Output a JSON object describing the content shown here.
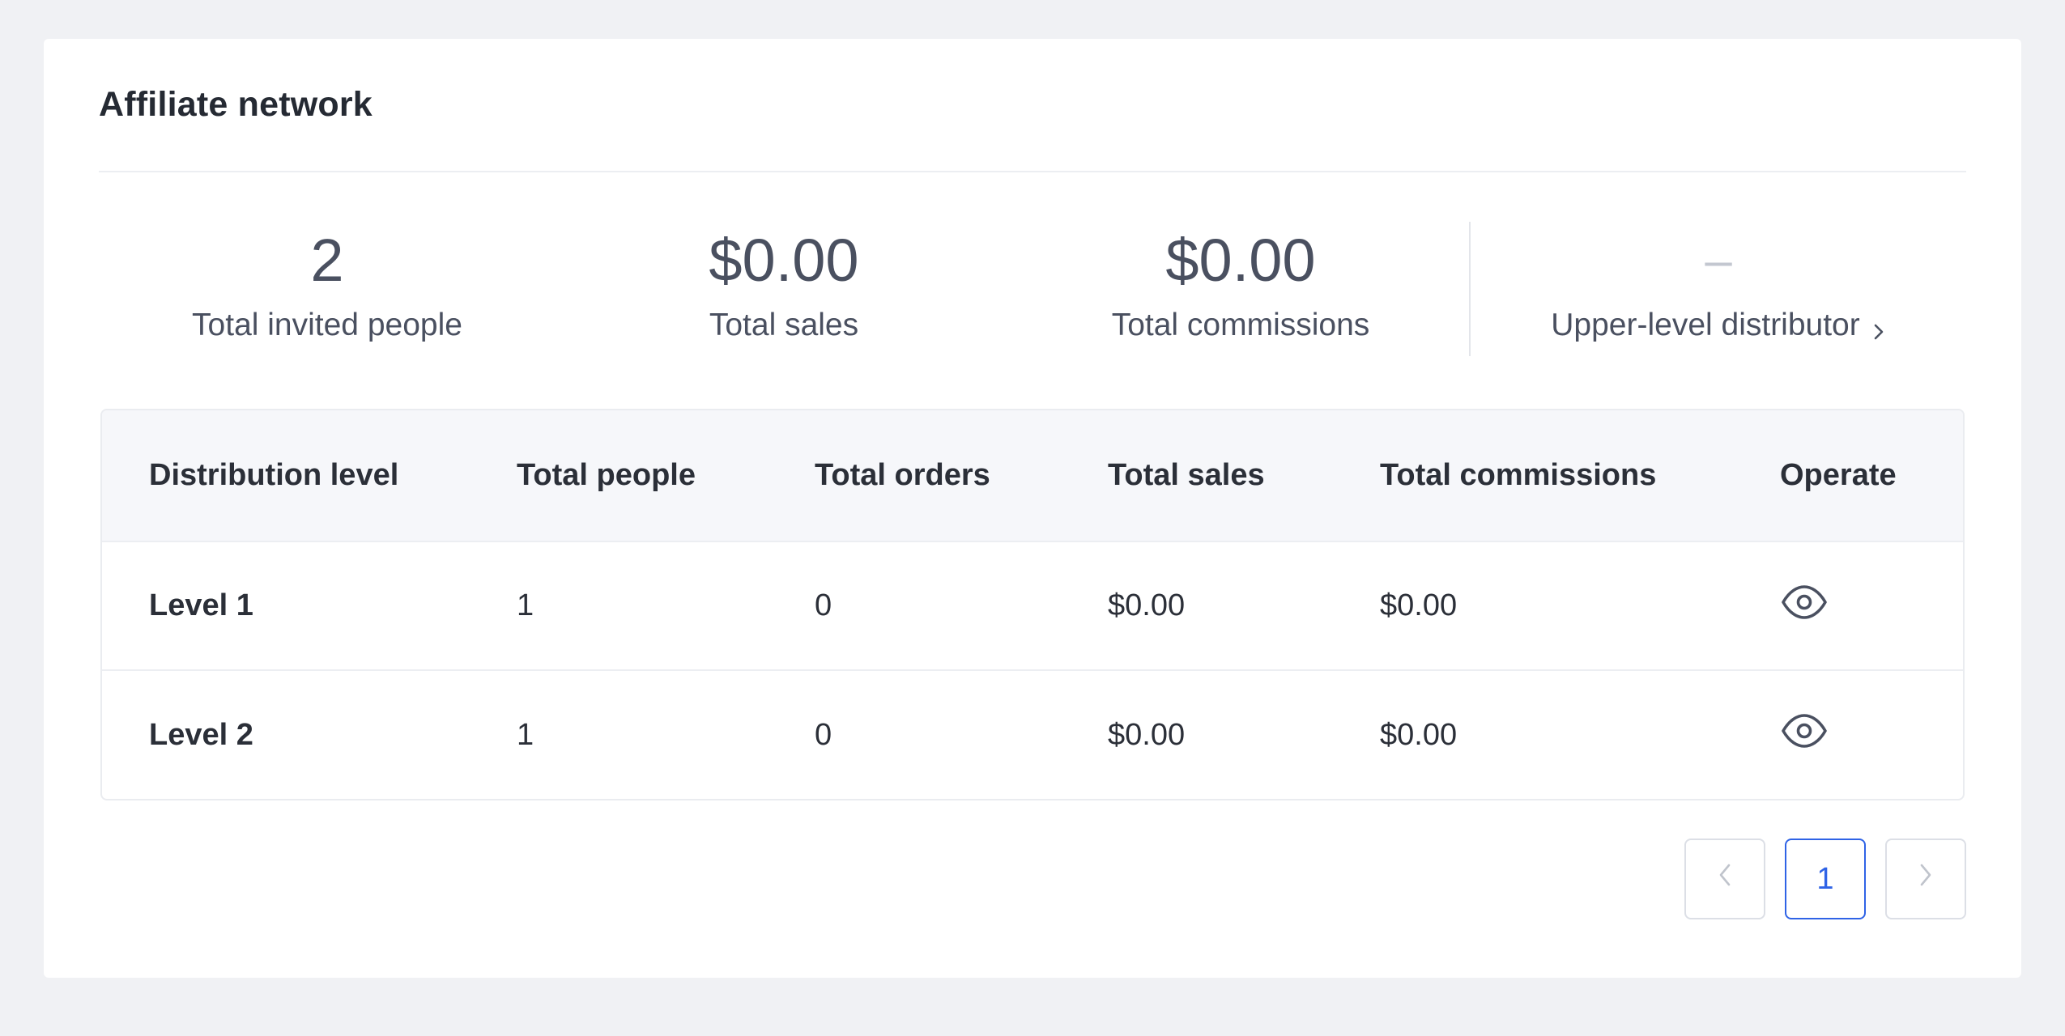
{
  "card": {
    "title": "Affiliate network"
  },
  "stats": {
    "invited": {
      "value": "2",
      "label": "Total invited people"
    },
    "sales": {
      "value": "$0.00",
      "label": "Total sales"
    },
    "commissions": {
      "value": "$0.00",
      "label": "Total commissions"
    },
    "upper": {
      "value": "–",
      "label": "Upper-level distributor",
      "icon": "chevron-right-icon"
    }
  },
  "table": {
    "headers": [
      "Distribution level",
      "Total people",
      "Total orders",
      "Total sales",
      "Total commissions",
      "Operate"
    ],
    "rows": [
      {
        "level": "Level 1",
        "people": "1",
        "orders": "0",
        "sales": "$0.00",
        "commissions": "$0.00",
        "operate_icon": "eye-icon"
      },
      {
        "level": "Level 2",
        "people": "1",
        "orders": "0",
        "sales": "$0.00",
        "commissions": "$0.00",
        "operate_icon": "eye-icon"
      }
    ]
  },
  "pagination": {
    "prev_icon": "chevron-left-icon",
    "current_page": "1",
    "next_icon": "chevron-right-icon"
  },
  "colors": {
    "accent": "#2f63e6",
    "background": "#f0f1f4",
    "header_bg": "#f6f7fa"
  }
}
